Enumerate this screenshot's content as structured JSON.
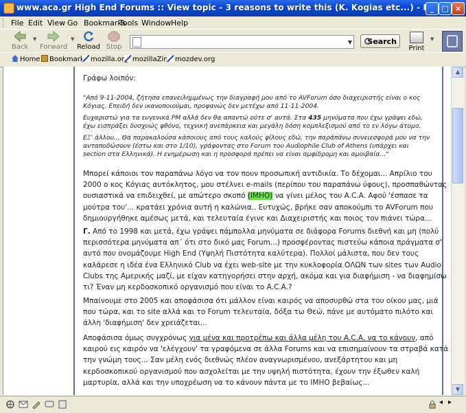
{
  "window": {
    "title": "www.aca.gr High End Forums :: View topic - 3 reasons to write this (K. Kogias etc...) - Mozilla",
    "controls": [
      "_",
      "□",
      "×"
    ]
  },
  "menu": [
    "File",
    "Edit",
    "View",
    "Go",
    "Bookmarks",
    "Tools",
    "Window",
    "Help"
  ],
  "nav": {
    "back_label": "Back",
    "forward_label": "Forward",
    "reload_label": "Reload",
    "stop_label": "Stop",
    "url_value": "",
    "search_label": "Search",
    "print_label": "Print"
  },
  "bookmarks": [
    "Home",
    "Bookmarks",
    "mozilla.org",
    "mozillaZine",
    "mozdev.org"
  ],
  "post": {
    "intro": "Γράφω λοιπόν:",
    "quote1": "\"Από 9-11-2004, ζήτησα επανειλημμένως την διαγραφή μου από το AVForum όσο διαχειριστής είναι ο κος Κόγιας. Επειδή δεν ικανοποιούμαι, προφανώς δεν μετέχω από 11-11-2004.",
    "quote2_a": "Ευχαριστώ για τα ευγενικά PM αλλά δεν θα απαντώ ούτε σ' αυτά. Στα ",
    "quote2_num": "435",
    "quote2_b": " μηνύματα που έχω γράψει εδώ, έχω εισπράξει δυσχυώς φθόνο, τεχνική ανεπάρκεια και μεγάλη δόση κομπλεξισμού από το εν λόγω άτομο.",
    "quote3": "ΕΞ' άλλου... Θα παρακαλούσα κάποιους από τους καλούς φίλους εδώ, την παράπάνω συνειεσφορά μου να την ανταποδώσουν (έστω και στο 1/10), γράφοντας στο Forum του Audiophile Club of Athens (υπάρχει και section στα Ελληνικά). Η ενημέρωση και η προσφορά πρέπει να είναι αμφίδρομη και αμοιβαία...\"",
    "para1_a": "Μπορεί κάποιοι τον παραπάνω λόγο να τον πουν προσωπική αντιδικία. Το δέχομαι... Απρίλιο του 2000 ο κος Κόγιας αυτόκλητος, μου στέλνει e-mails (περίπου του παραπάνω ύφους), προσπαθώντας ουσιαστικά να επιδειχθεί, με απώτερο σκοπό ",
    "para1_hl": "(ΙΜΗΟ)",
    "para1_b": " να γίνει μέλος του A.C.A. Αφού 'έσπασε τα μούτρα του'... κρατάει χρόνια αυτή η καλώνια.. Ευτυχώς, βρήκε σαν αποκούμπι το AVForum που δημιουργήθηκε αμέσως μετά, και τελευταία έγινε και Διαχειριστής και ποιος τον πιάνει τώρα...",
    "para2_lead": "Γ.",
    "para2": " Από το 1998 και μετά, έχω γράψει πάμπολλα μηνύματα σε διάφορα Forums διεθνή και μη (πολύ περισσότερα μηνύματα απ΄ ότι στο δικό μας Forum...) προσφέροντας πιστεύω κάποια πράγματα σ' αυτό που ονομάζουμε High End (Υψηλή Πιστότητα καλύτερα). Πολλοί μάλιστα, που δεν τους καλάρεσε η ιδέα ένα Ελληνικό Club να έχει web-site με την κυκλοφορία ΟΛΩΝ των sites των Audio Clubs της Αμερικής μαζί, με είχαν κατηγορήσει στην αρχή, ακόμα και για διαφήμιση - να διαφημίσω τι? Έναν μη κερδοσκοπικό οργανισμό που είναι το A.C.A.?",
    "para3": "Μπαίνουμε στο 2005 και αποφάσισα ότι μάλλον είναι καιρός να αποσυρθώ στα του οίκου μας, μιά που τώρα, και το site αλλά και το Forum τελευταία, δόξα τω Θεώ, πάνε με αυτόματο πιλότο και άλλη 'διαφήμιση' δεν χρειάζεται...",
    "para4_a": "Αποφάσισα όμως συγχρόνως ",
    "para4_ul": "για μένα και προτρέπω και άλλα μέλη του A.C.A. να το κάνουν",
    "para4_b": ", από καιρού εις καιρόν να 'ελέγχουν' τα γραφόμενα σε άλλα Forums και να επισημαίνουν τα στραβά κατά την γνώμη τους... Σαν μέλη ενός διεθνώς πλέον αναγνωρισμένου, ανεξάρτητου και μη κερδοσκοπικού οργανισμού που ασχολείται με την υψηλή πιστότητα, έχουν την έξωθεν καλή μαρτυρία, αλλά και την υποχρέωση να το κάνουν πάντα με το IMHO βεβαίως..."
  },
  "colors": {
    "titlebar": "#0a49d6",
    "highlight": "#69e34a",
    "chrome": "#ece9d8"
  }
}
